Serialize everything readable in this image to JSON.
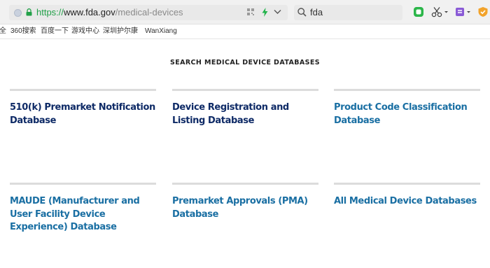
{
  "browser": {
    "url": {
      "scheme": "https://",
      "host": "www.fda.gov",
      "path": "/medical-devices"
    },
    "search": {
      "query": "fda"
    },
    "bookmarks": [
      "全",
      "360搜索",
      "百度一下",
      "游戏中心",
      "深圳护尔康",
      "WanXiang"
    ]
  },
  "page": {
    "section_title": "SEARCH MEDICAL DEVICE DATABASES",
    "databases": [
      {
        "title": "510(k) Premarket Notification Database",
        "color": "#0e2a66"
      },
      {
        "title": "Device Registration and Listing Database",
        "color": "#0e2a66"
      },
      {
        "title": "Product Code Classification Database",
        "color": "#1a6fa3"
      },
      {
        "title": "MAUDE (Manufacturer and User Facility Device Experience) Database",
        "color": "#1a6fa3"
      },
      {
        "title": "Premarket Approvals (PMA) Database",
        "color": "#1a6fa3"
      },
      {
        "title": "All Medical Device Databases",
        "color": "#1a6fa3"
      }
    ]
  },
  "icons": {
    "page": "page-icon",
    "lock": "lock-icon",
    "qr": "qr-code-icon",
    "bolt": "lightning-icon",
    "dropdown": "chevron-down-icon",
    "search": "search-icon",
    "ext1": "green-extension-icon",
    "ext2": "scissors-icon",
    "ext3": "purple-extension-icon",
    "ext4": "shield-icon"
  }
}
